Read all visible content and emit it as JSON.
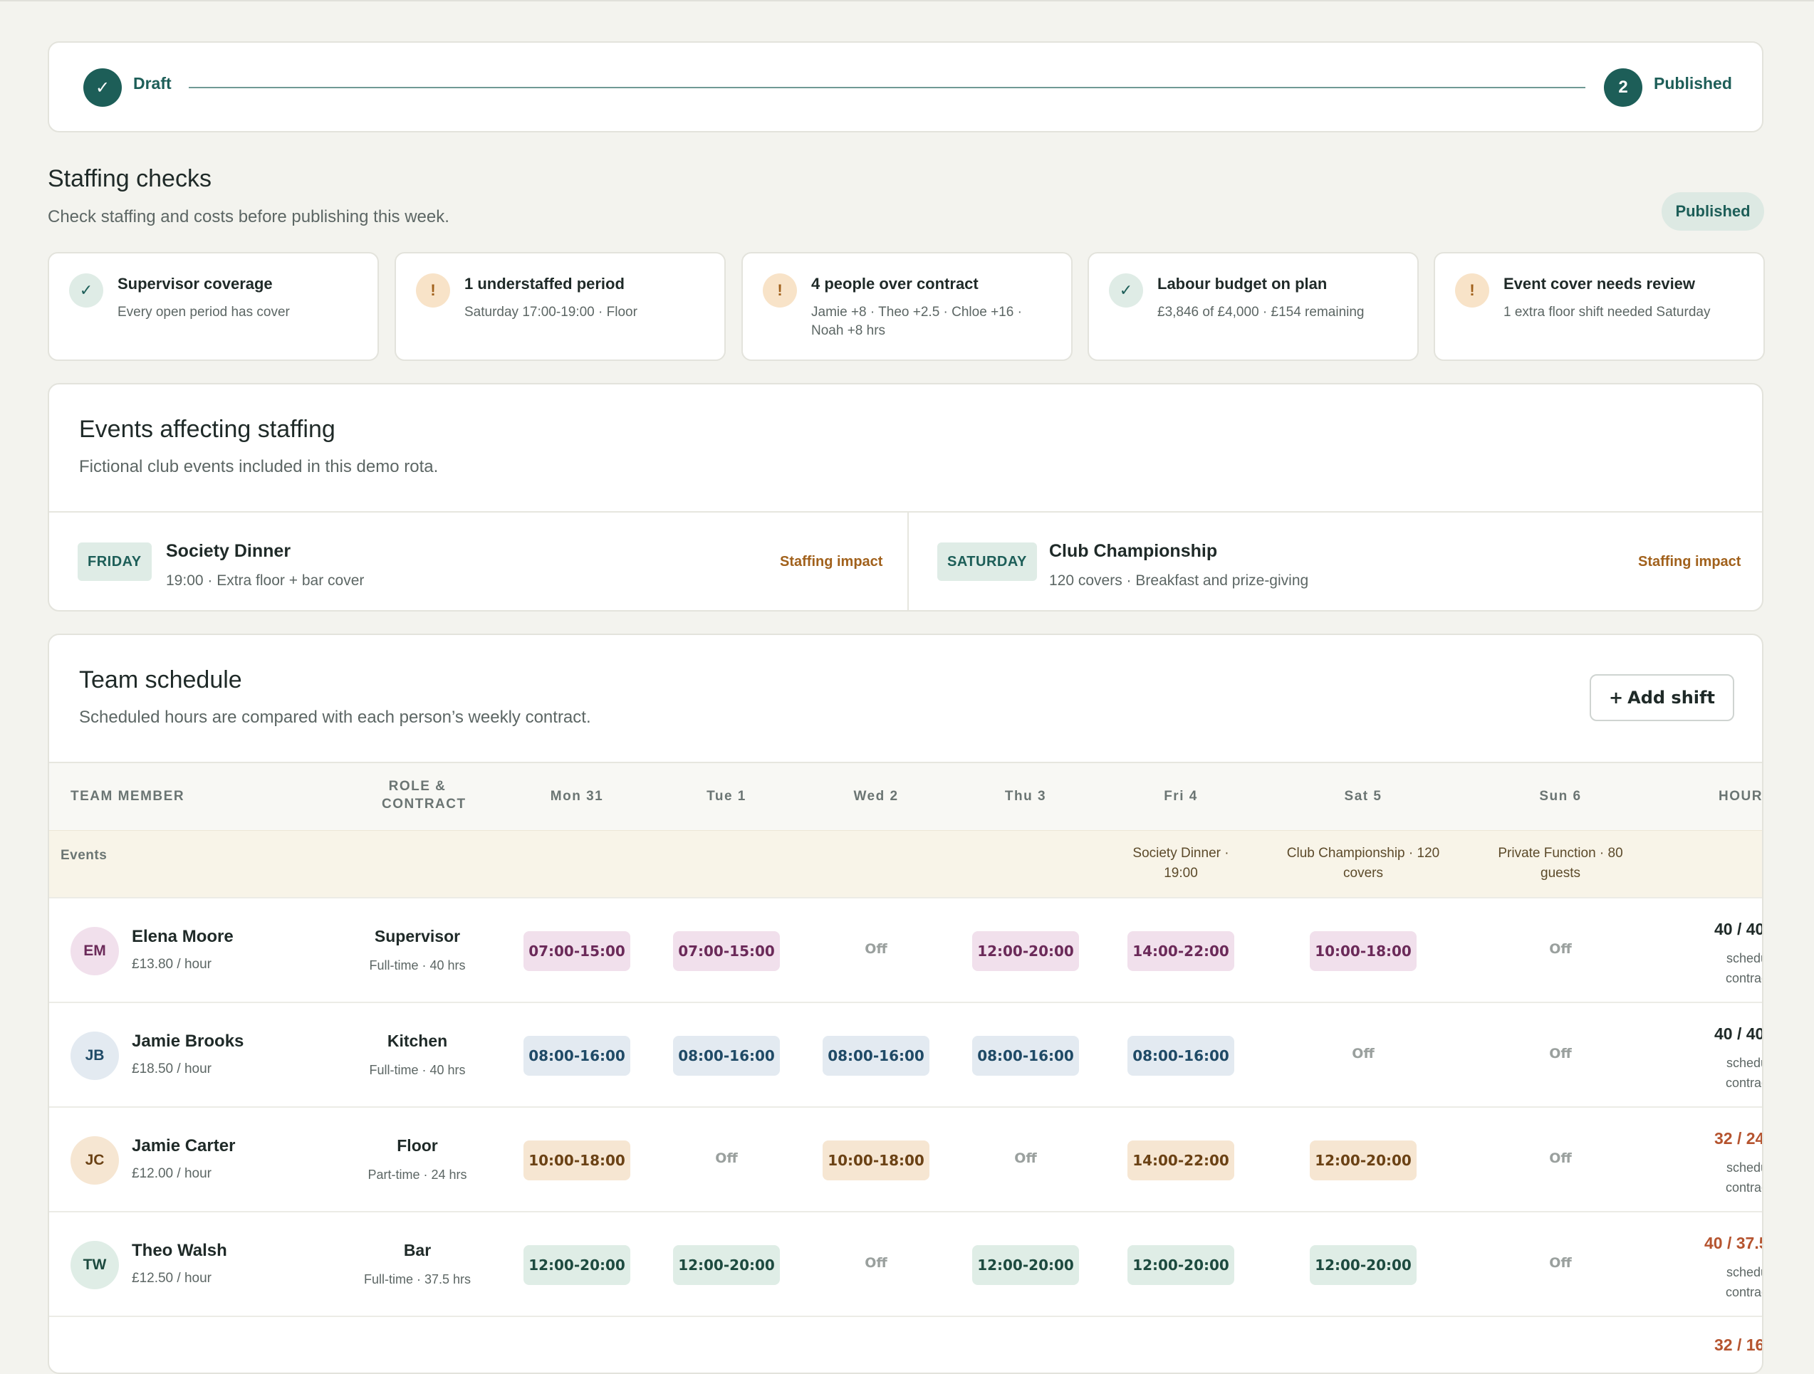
{
  "progress": {
    "steps": [
      {
        "label": "Draft",
        "icon": "check-icon",
        "mark": "✓"
      },
      {
        "label": "Published",
        "number": "2"
      }
    ]
  },
  "staffing": {
    "title": "Staffing checks",
    "subtitle": "Check staffing and costs before publishing this week.",
    "status": "Published",
    "checks": [
      {
        "status": "ok",
        "title": "Supervisor coverage",
        "detail": "Every open period has cover"
      },
      {
        "status": "warn",
        "title": "1 understaffed period",
        "detail": "Saturday 17:00-19:00 · Floor"
      },
      {
        "status": "warn",
        "title": "4 people over contract",
        "detail": "Jamie +8 · Theo +2.5 · Chloe +16 · Noah +8 hrs"
      },
      {
        "status": "ok",
        "title": "Labour budget on plan",
        "detail": "£3,846 of £4,000 · £154 remaining"
      },
      {
        "status": "warn",
        "title": "Event cover needs review",
        "detail": "1 extra floor shift needed Saturday"
      }
    ]
  },
  "events": {
    "title": "Events affecting staffing",
    "subtitle": "Fictional club events included in this demo rota.",
    "items": [
      {
        "day": "FRIDAY",
        "name": "Society Dinner",
        "detail": "19:00 · Extra floor + bar cover",
        "impact": "Staffing impact"
      },
      {
        "day": "SATURDAY",
        "name": "Club Championship",
        "detail": "120 covers · Breakfast and prize-giving",
        "impact": "Staffing impact"
      }
    ]
  },
  "team": {
    "title": "Team schedule",
    "subtitle": "Scheduled hours are compared with each person’s weekly contract.",
    "add_shift": "Add shift",
    "add_shift_plus": "+",
    "columns": {
      "member": "TEAM MEMBER",
      "role_l1": "ROLE &",
      "role_l2": "CONTRACT",
      "days": [
        "Mon 31",
        "Tue 1",
        "Wed 2",
        "Thu 3",
        "Fri 4",
        "Sat 5",
        "Sun 6"
      ],
      "hours": "HOURS"
    },
    "events_row": {
      "label": "Events",
      "fri_l1": "Society Dinner ·",
      "fri_l2": "19:00",
      "sat_l1": "Club Championship · 120",
      "sat_l2": "covers",
      "sun_l1": "Private Function · 80",
      "sun_l2": "guests"
    },
    "members": [
      {
        "initials": "EM",
        "name": "Elena Moore",
        "rate": "£13.80 / hour",
        "role": "Supervisor",
        "contract": "Full-time · 40 hrs",
        "shifts": [
          "07:00-15:00",
          "07:00-15:00",
          "Off",
          "12:00-20:00",
          "14:00-22:00",
          "10:00-18:00",
          "Off"
        ],
        "hours": "40 / 40",
        "hours_sub_l1": "scheduled",
        "hours_sub_l2": "contracted",
        "over": false
      },
      {
        "initials": "JB",
        "name": "Jamie Brooks",
        "rate": "£18.50 / hour",
        "role": "Kitchen",
        "contract": "Full-time · 40 hrs",
        "shifts": [
          "08:00-16:00",
          "08:00-16:00",
          "08:00-16:00",
          "08:00-16:00",
          "08:00-16:00",
          "Off",
          "Off"
        ],
        "hours": "40 / 40",
        "hours_sub_l1": "scheduled",
        "hours_sub_l2": "contracted",
        "over": false
      },
      {
        "initials": "JC",
        "name": "Jamie Carter",
        "rate": "£12.00 / hour",
        "role": "Floor",
        "contract": "Part-time · 24 hrs",
        "shifts": [
          "10:00-18:00",
          "Off",
          "10:00-18:00",
          "Off",
          "14:00-22:00",
          "12:00-20:00",
          "Off"
        ],
        "hours": "32 / 24",
        "hours_sub_l1": "scheduled",
        "hours_sub_l2": "contracted",
        "over": true
      },
      {
        "initials": "TW",
        "name": "Theo Walsh",
        "rate": "£12.50 / hour",
        "role": "Bar",
        "contract": "Full-time · 37.5 hrs",
        "shifts": [
          "12:00-20:00",
          "12:00-20:00",
          "Off",
          "12:00-20:00",
          "12:00-20:00",
          "12:00-20:00",
          "Off"
        ],
        "hours": "40 / 37.5",
        "hours_sub_l1": "scheduled",
        "hours_sub_l2": "contracted",
        "over": true
      }
    ],
    "partial_hours": "32 / 16"
  },
  "colors": {
    "accent": "#1d5e58",
    "warning": "#a1611c",
    "over_contract": "#b5542f",
    "supervisor": "#f1e0ec",
    "kitchen": "#e3eaf1",
    "floor": "#f6e6d2",
    "bar": "#dfede6"
  }
}
